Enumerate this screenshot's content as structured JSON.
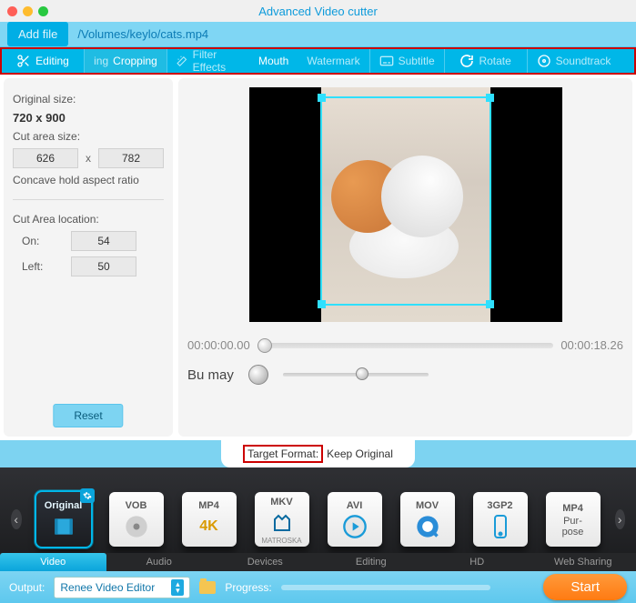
{
  "title": "Advanced Video cutter",
  "toolbar": {
    "add_file": "Add file",
    "filepath": "/Volumes/keylo/cats.mp4"
  },
  "tabs": {
    "editing": "Editing",
    "cropping_prefix": "ing",
    "cropping": "Cropping",
    "filter_effects": "Filter Effects",
    "mouth": "Mouth",
    "watermark": "Watermark",
    "subtitle": "Subtitle",
    "rotate": "Rotate",
    "soundtrack": "Soundtrack"
  },
  "side": {
    "original_size_label": "Original size:",
    "original_size": "720 x 900",
    "cut_area_label": "Cut area size:",
    "cut_w": "626",
    "cut_h": "782",
    "x": "x",
    "aspect": "Concave hold aspect ratio",
    "location_label": "Cut Area location:",
    "on_label": "On:",
    "on_val": "54",
    "left_label": "Left:",
    "left_val": "50",
    "reset": "Reset"
  },
  "preview": {
    "time_start": "00:00:00.00",
    "time_end": "00:00:18.26",
    "bumay": "Bu may"
  },
  "format": {
    "label": "Target Format:",
    "value": "Keep Original"
  },
  "formats": {
    "original": "Original",
    "vob": "VOB",
    "mp4": "MP4",
    "fourk": "4K",
    "mkv": "MKV",
    "mkv_sub": "MATROSKA",
    "avi": "AVI",
    "mov": "MOV",
    "tgp2": "3GP2",
    "mp4p": "MP4",
    "purpose": "Pur-\npose"
  },
  "cats": {
    "video": "Video",
    "audio": "Audio",
    "devices": "Devices",
    "editing": "Editing",
    "hd": "HD",
    "web": "Web Sharing"
  },
  "bottom": {
    "output": "Output:",
    "select": "Renee Video Editor",
    "progress": "Progress:",
    "start": "Start"
  }
}
